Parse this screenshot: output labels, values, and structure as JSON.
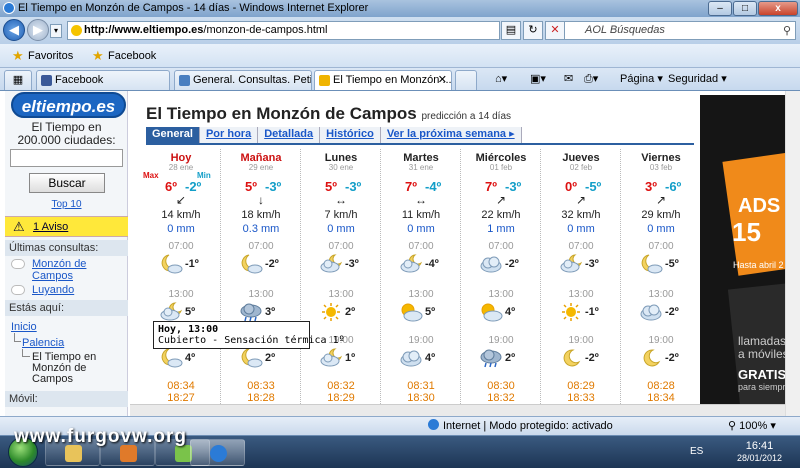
{
  "window": {
    "title": "El Tiempo en Monzón de Campos - 14 días - Windows Internet Explorer",
    "minimize": "–",
    "restore": "□",
    "close": "x"
  },
  "address": {
    "host": "http://www.eltiempo.es",
    "path": "/monzon-de-campos.html"
  },
  "search": {
    "placeholder": "AOL Búsquedas"
  },
  "favorites": {
    "label": "Favoritos",
    "items": [
      "Facebook"
    ]
  },
  "tabs": [
    {
      "label": "Facebook"
    },
    {
      "label": "General. Consultas. Petició..."
    },
    {
      "label": "El Tiempo en Monzón ..."
    }
  ],
  "toolbar": {
    "page": "Página",
    "security": "Seguridad"
  },
  "sidebar": {
    "logo": "eltiempo.es",
    "tagline1": "El Tiempo en",
    "tagline2": "200.000 ciudades:",
    "search_button": "Buscar",
    "top10": "Top 10",
    "aviso": "1 Aviso",
    "recent_header": "Últimas consultas:",
    "recent": [
      "Monzón de",
      "Campos",
      "Luyando"
    ],
    "here_header": "Estás aquí:",
    "breadcrumb": [
      "Inicio",
      "Palencia",
      "El Tiempo en",
      "Monzón de",
      "Campos"
    ],
    "mobile_header": "Móvil:"
  },
  "main": {
    "title": "El Tiempo en Monzón de Campos",
    "subtitle": "predicción a 14 días",
    "tabs": [
      "General",
      "Por hora",
      "Detallada",
      "Histórico",
      "Ver la próxima semana ▸"
    ],
    "max_label": "Max",
    "min_label": "Min",
    "hours": [
      "07:00",
      "13:00",
      "19:00"
    ],
    "days": [
      {
        "name": "Hoy",
        "date": "28 ene",
        "max": "6º",
        "min": "-2º",
        "arrow": "↙",
        "wind": "14 km/h",
        "rain": "0 mm",
        "t07": "-1º",
        "t13": "5º",
        "t19": "4º",
        "sunrise": "08:34",
        "sunset": "18:27",
        "i07": "moon-cloud",
        "i13": "cloud-moon",
        "i19": "moon-cloud"
      },
      {
        "name": "Mañana",
        "date": "29 ene",
        "max": "5º",
        "min": "-3º",
        "arrow": "↓",
        "wind": "18 km/h",
        "rain": "0.3 mm",
        "t07": "-2º",
        "t13": "3º",
        "t19": "2º",
        "sunrise": "08:33",
        "sunset": "18:28",
        "i07": "moon-cloud",
        "i13": "cloud-rain",
        "i19": "moon-cloud"
      },
      {
        "name": "Lunes",
        "date": "30 ene",
        "max": "5º",
        "min": "-3º",
        "arrow": "↔",
        "wind": "7 km/h",
        "rain": "0 mm",
        "t07": "-3º",
        "t13": "2º",
        "t19": "1º",
        "sunrise": "08:32",
        "sunset": "18:29",
        "i07": "cloud-moon",
        "i13": "sun",
        "i19": "cloud-moon"
      },
      {
        "name": "Martes",
        "date": "31 ene",
        "max": "7º",
        "min": "-4º",
        "arrow": "↔",
        "wind": "11 km/h",
        "rain": "0 mm",
        "t07": "-4º",
        "t13": "5º",
        "t19": "4º",
        "sunrise": "08:31",
        "sunset": "18:30",
        "i07": "cloud-moon",
        "i13": "sun-cloud",
        "i19": "cloud"
      },
      {
        "name": "Miércoles",
        "date": "01 feb",
        "max": "7º",
        "min": "-3º",
        "arrow": "↗",
        "wind": "22 km/h",
        "rain": "1 mm",
        "t07": "-2º",
        "t13": "4º",
        "t19": "2º",
        "sunrise": "08:30",
        "sunset": "18:32",
        "i07": "cloud",
        "i13": "sun-cloud",
        "i19": "cloud-rain"
      },
      {
        "name": "Jueves",
        "date": "02 feb",
        "max": "0º",
        "min": "-5º",
        "arrow": "↗",
        "wind": "32 km/h",
        "rain": "0 mm",
        "t07": "-3º",
        "t13": "-1º",
        "t19": "-2º",
        "sunrise": "08:29",
        "sunset": "18:33",
        "i07": "cloud-moon",
        "i13": "sun",
        "i19": "moon"
      },
      {
        "name": "Viernes",
        "date": "03 feb",
        "max": "3º",
        "min": "-6º",
        "arrow": "↗",
        "wind": "29 km/h",
        "rain": "0 mm",
        "t07": "-5º",
        "t13": "-2º",
        "t19": "-2º",
        "sunrise": "08:28",
        "sunset": "18:34",
        "i07": "moon-cloud",
        "i13": "cloud",
        "i19": "moon"
      }
    ]
  },
  "tooltip": {
    "line1": "Hoy, 13:00",
    "line2": "Cubierto - Sensación térmica 1º"
  },
  "ad": {
    "t1": "ADS",
    "t2": "15",
    "t3": "Hasta abril 2",
    "t4": "llamadas",
    "t4b": "a móviles",
    "t5": "GRATIS",
    "t6": "para siempre"
  },
  "status": {
    "zone": "Internet | Modo protegido: activado",
    "zoom": "100%"
  },
  "taskbar": {
    "lang": "ES",
    "time": "16:41",
    "date": "28/01/2012"
  },
  "watermark": "www.furgovw.org",
  "colors": {
    "accent": "#2c5fa0",
    "max": "#d11111",
    "min": "#129ec8",
    "link": "#1a57c8",
    "sun": "#e07a00"
  }
}
